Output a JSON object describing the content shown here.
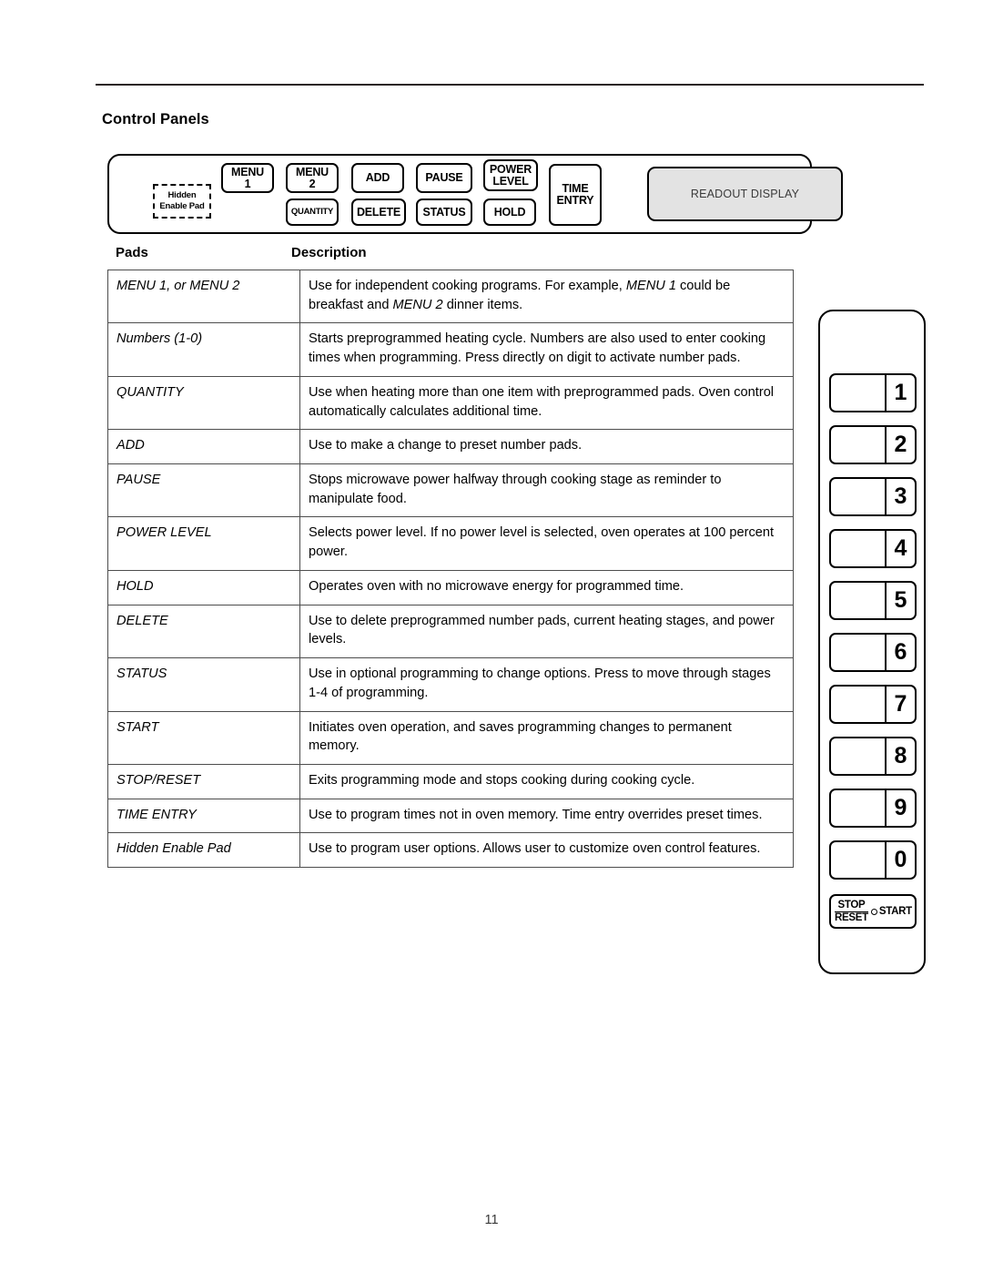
{
  "page": {
    "section_title": "Control Panels",
    "page_number": "11"
  },
  "control_panel": {
    "hidden_pad": {
      "line1": "Hidden",
      "line2": "Enable Pad"
    },
    "buttons": [
      {
        "name": "menu-1",
        "line1": "MENU",
        "line2": "1"
      },
      {
        "name": "menu-2",
        "line1": "MENU",
        "line2": "2"
      },
      {
        "name": "add",
        "line1": "ADD",
        "line2": ""
      },
      {
        "name": "pause",
        "line1": "PAUSE",
        "line2": ""
      },
      {
        "name": "power-level",
        "line1": "POWER",
        "line2": "LEVEL"
      },
      {
        "name": "time-entry",
        "line1": "TIME",
        "line2": "ENTRY"
      },
      {
        "name": "quantity",
        "line1": "QUANTITY",
        "line2": ""
      },
      {
        "name": "delete",
        "line1": "DELETE",
        "line2": ""
      },
      {
        "name": "status",
        "line1": "STATUS",
        "line2": ""
      },
      {
        "name": "hold",
        "line1": "HOLD",
        "line2": ""
      }
    ],
    "readout_display": "READOUT DISPLAY"
  },
  "table": {
    "headers": {
      "pads": "Pads",
      "description": "Description"
    },
    "rows": [
      {
        "pad": "MENU 1, or MENU 2",
        "description": "Use for independent cooking programs. For example, MENU 1 could be breakfast and MENU 2 dinner items."
      },
      {
        "pad": "Numbers (1-0)",
        "description": "Starts preprogrammed heating cycle. Numbers are also used to enter cooking times when programming.  Press directly on digit to activate number pads."
      },
      {
        "pad": "QUANTITY",
        "description": "Use when heating more than one item with preprogrammed pads. Oven control automatically calculates additional time."
      },
      {
        "pad": "ADD",
        "description": "Use to make a change to preset number pads."
      },
      {
        "pad": "PAUSE",
        "description": "Stops microwave power halfway through cooking stage as reminder to manipulate food."
      },
      {
        "pad": "POWER LEVEL",
        "description": "Selects power level.  If no power level is selected, oven operates at 100 percent power."
      },
      {
        "pad": "HOLD",
        "description": "Operates oven with no microwave energy for programmed time."
      },
      {
        "pad": "DELETE",
        "description": "Use to delete preprogrammed number pads, current heating stages, and power levels."
      },
      {
        "pad": "STATUS",
        "description": "Use in optional programming to change options.  Press to move through stages 1-4 of programming."
      },
      {
        "pad": "START",
        "description": "Initiates oven operation, and saves programming changes to permanent memory."
      },
      {
        "pad": "STOP/RESET",
        "description": "Exits programming mode and stops cooking during cooking cycle."
      },
      {
        "pad": "TIME ENTRY",
        "description": "Use to program times not in oven memory. Time entry overrides preset times."
      },
      {
        "pad": "Hidden Enable Pad",
        "description": "Use to program user options. Allows user to customize oven control features."
      }
    ]
  },
  "keypad": {
    "digits": [
      "1",
      "2",
      "3",
      "4",
      "5",
      "6",
      "7",
      "8",
      "9",
      "0"
    ],
    "stop_reset": {
      "stop": "STOP",
      "reset": "RESET"
    },
    "start": "START"
  }
}
